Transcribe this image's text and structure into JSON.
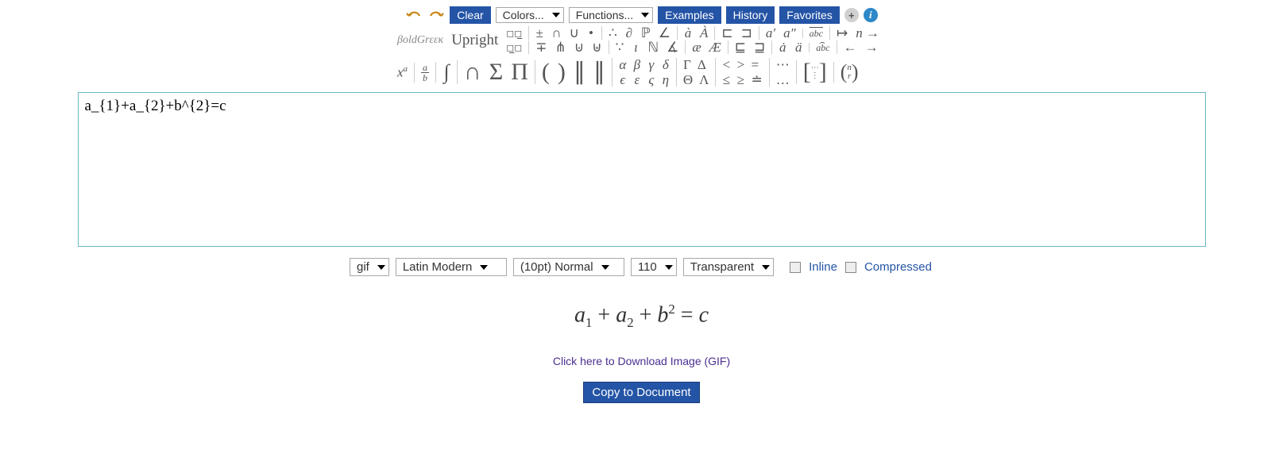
{
  "toolbar": {
    "clear_label": "Clear",
    "colors_label": "Colors...",
    "functions_label": "Functions...",
    "examples_label": "Examples",
    "history_label": "History",
    "favorites_label": "Favorites"
  },
  "style_labels": {
    "bold_greek": "βoldGrεεκ",
    "upright": "Upright"
  },
  "symbols": {
    "row1_box1": "◻◻̲",
    "row1_pm": "±",
    "row1_cap": "∩",
    "row1_cup": "∪",
    "row1_dot": "•",
    "row1_therefore": "∴",
    "row1_partial": "∂",
    "row1_bbP": "ℙ",
    "row1_angle": "∠",
    "row1_grave": "à",
    "row1_acute": "À",
    "row1_sqsub": "⊏",
    "row1_sqsup": "⊐",
    "row1_prime": "a′",
    "row1_dprime": "a″",
    "row1_overline": "abc",
    "row1_mapsto": "↦",
    "row1_nright": "n →",
    "row2_box2": "◻̲◻",
    "row2_mp": "∓",
    "row2_pitchfork": "⋔",
    "row2_uplus": "⊍",
    "row2_buplus": "⊎",
    "row2_because": "∵",
    "row2_imath": "ı",
    "row2_bbN": "ℕ",
    "row2_measang": "∡",
    "row2_ae": "æ",
    "row2_AE": "Æ",
    "row2_sqsubeq": "⊑",
    "row2_sqsupeq": "⊒",
    "row2_dot_a": "ȧ",
    "row2_ddot_a": "ä",
    "row2_hat_abc": "abc",
    "row2_left": "←",
    "row2_right": "→",
    "row3_xa": "x",
    "row3_xa_sup": "a",
    "row3_frac_a": "a",
    "row3_frac_b": "b",
    "row3_int": "∫",
    "row3_bigcap": "∩",
    "row3_sum": "Σ",
    "row3_prod": "Π",
    "row3_lparen": "(",
    "row3_rparen": ")",
    "row3_vert": "∥",
    "row3_dvert": "∥",
    "row3_alpha": "α",
    "row3_beta": "β",
    "row3_gamma": "γ",
    "row3_delta": "δ",
    "row3_Gamma": "Γ",
    "row3_Delta": "Δ",
    "row3_lt": "<",
    "row3_gt": ">",
    "row3_eq": "=",
    "row3_cdots": "⋯",
    "row4_eps": "ϵ",
    "row4_vareps": "ε",
    "row4_varsigma": "ς",
    "row4_eta": "η",
    "row4_Theta": "Θ",
    "row4_Lambda": "Λ",
    "row4_leq": "≤",
    "row4_geq": "≥",
    "row4_doteq": "≐",
    "row4_ldots": "…",
    "row3_matrix_l": "[",
    "row3_matrix_dots": "⋯\n⋮",
    "row3_matrix_r": "]",
    "row3_binom_l": "(",
    "row3_binom_n": "n",
    "row3_binom_r": "r",
    "row3_binom_rp": ")"
  },
  "formula_input": "a_{1}+a_{2}+b^{2}=c",
  "output_controls": {
    "format": "gif",
    "font": "Latin Modern",
    "size": "(10pt) Normal",
    "dpi": "110",
    "bg": "Transparent",
    "inline_label": "Inline",
    "compressed_label": "Compressed"
  },
  "rendered_formula_html": "a<sub>1</sub> + a<sub>2</sub> + b<sup>2</sup> = c",
  "download_link_label": "Click here to Download Image (GIF)",
  "copy_button_label": "Copy to Document"
}
